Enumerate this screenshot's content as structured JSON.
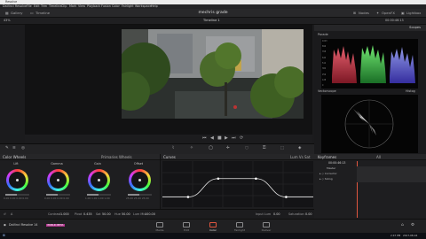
{
  "window": {
    "title": "Resolve"
  },
  "menu": {
    "items": [
      "DaVinci Resolve",
      "File",
      "Edit",
      "Trim",
      "Timeline",
      "Clip",
      "Mark",
      "View",
      "Playback",
      "Fusion",
      "Color",
      "Fairlight",
      "Workspace",
      "Help"
    ]
  },
  "toolbar": {
    "left": [
      "Gallery",
      "Timeline"
    ],
    "project_title": "mechris grade",
    "right": [
      "Nodes",
      "OpenFX",
      "Lightbox"
    ]
  },
  "subbar": {
    "zoom": "43%",
    "timeline_name": "Timeline 1",
    "timecode": "00:00:46:13"
  },
  "viewer": {
    "controls": [
      "⏮",
      "◀",
      "■",
      "▶",
      "⏭",
      "⟳"
    ]
  },
  "scopes": {
    "title": "Scopes",
    "parade": {
      "label": "Parade",
      "scale": [
        "1023",
        "896",
        "768",
        "640",
        "512",
        "384",
        "256",
        "128",
        "0"
      ]
    },
    "vectorscope": {
      "label": "Vectorscope",
      "extra_label": "Histog"
    }
  },
  "color_wheels": {
    "title": "Color Wheels",
    "mode": "Primaries Wheels",
    "wheels": [
      {
        "name": "Lift",
        "values": [
          "0.00",
          "0.00",
          "0.00",
          "0.00"
        ]
      },
      {
        "name": "Gamma",
        "values": [
          "0.00",
          "0.00",
          "0.00",
          "0.00"
        ]
      },
      {
        "name": "Gain",
        "values": [
          "1.00",
          "1.00",
          "1.00",
          "1.00"
        ]
      },
      {
        "name": "Offset",
        "values": [
          "25.00",
          "25.00",
          "25.00"
        ]
      }
    ],
    "wheel_channels": [
      "Y",
      "R",
      "G",
      "B"
    ]
  },
  "curves": {
    "title": "Curves",
    "mode": "Lum Vs Sat",
    "points_norm": [
      [
        0.17,
        0.78
      ],
      [
        0.37,
        0.38
      ],
      [
        0.62,
        0.38
      ],
      [
        0.82,
        0.78
      ]
    ],
    "input_label": "Input Lum",
    "input_value": "0.00",
    "output_label": "Saturation",
    "output_value": "0.00"
  },
  "keyframes": {
    "title": "Keyframes",
    "filter": "All",
    "timecode": "00:00:46:13",
    "rows": [
      "Master",
      "Corrector",
      "Sizing"
    ]
  },
  "bottom_bar": {
    "contrast_label": "Contrast",
    "contrast_value": "1.000",
    "pivot_label": "Pivot",
    "pivot_value": "0.435",
    "sat_label": "Sat",
    "sat_value": "50.00",
    "hue_label": "Hue",
    "hue_value": "50.00",
    "lum_mix_label": "Lum Mix",
    "lum_mix_value": "100.00"
  },
  "pagebar": {
    "app_name": "DaVinci Resolve 14",
    "badge": "PUBLIC BETA",
    "pages": [
      "Media",
      "Edit",
      "Color",
      "Fairlight",
      "Deliver"
    ],
    "active_page": "Color"
  },
  "taskbar": {
    "clock": "2:47 PM",
    "date": "2017-08-16"
  },
  "colors": {
    "accent": "#e0563f",
    "panel_bg": "#1e1e20",
    "window_bg": "#1b1b1d"
  }
}
